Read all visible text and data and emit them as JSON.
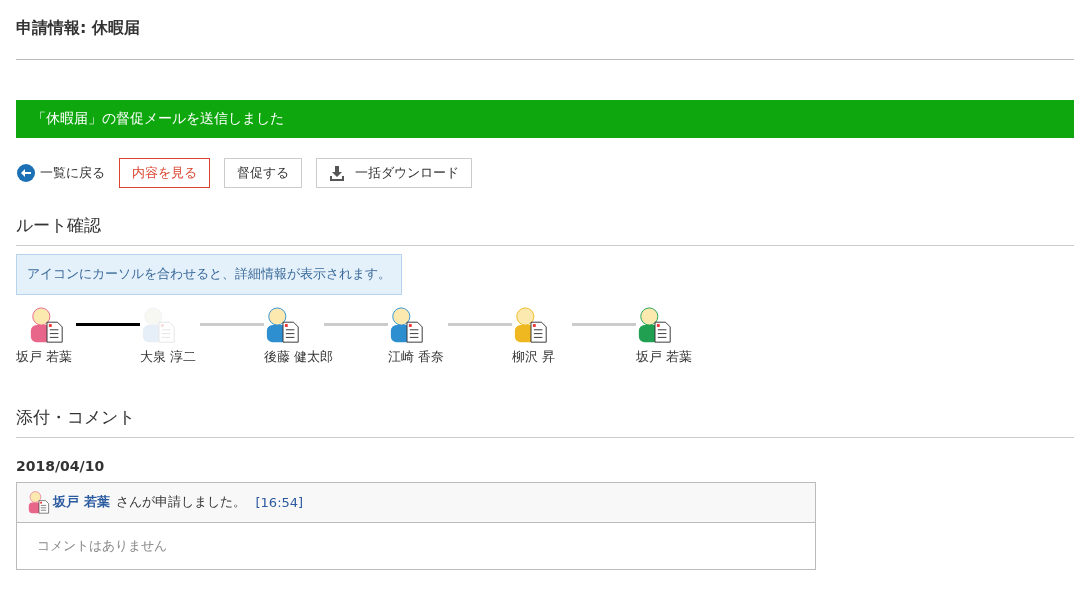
{
  "title": "申請情報: 休暇届",
  "notice": "「休暇届」の督促メールを送信しました",
  "actions": [
    {
      "kind": "back",
      "label": "一覧に戻る"
    },
    {
      "kind": "primary",
      "label": "内容を見る"
    },
    {
      "kind": "plain",
      "label": "督促する"
    },
    {
      "kind": "download",
      "label": "一括ダウンロード"
    }
  ],
  "route": {
    "heading": "ルート確認",
    "hint": "アイコンにカーソルを合わせると、詳細情報が表示されます。",
    "steps": [
      {
        "name": "坂戸 若葉",
        "color": "#e8668a",
        "faded": false
      },
      {
        "name": "大泉 淳二",
        "color": "#e6eff8",
        "faded": true,
        "line_done": true
      },
      {
        "name": "後藤 健太郎",
        "color": "#2e8fd0",
        "faded": false,
        "line_done": false
      },
      {
        "name": "江崎 香奈",
        "color": "#2e8fd0",
        "faded": false,
        "line_done": false
      },
      {
        "name": "柳沢 昇",
        "color": "#f0b820",
        "faded": false,
        "line_done": false
      },
      {
        "name": "坂戸 若葉",
        "color": "#20a050",
        "faded": false,
        "line_done": false
      }
    ]
  },
  "comments": {
    "heading": "添付・コメント",
    "date": "2018/04/10",
    "entry": {
      "user": "坂戸 若葉",
      "text": "さんが申請しました。",
      "time": "[16:54]",
      "body": "コメントはありません"
    }
  }
}
